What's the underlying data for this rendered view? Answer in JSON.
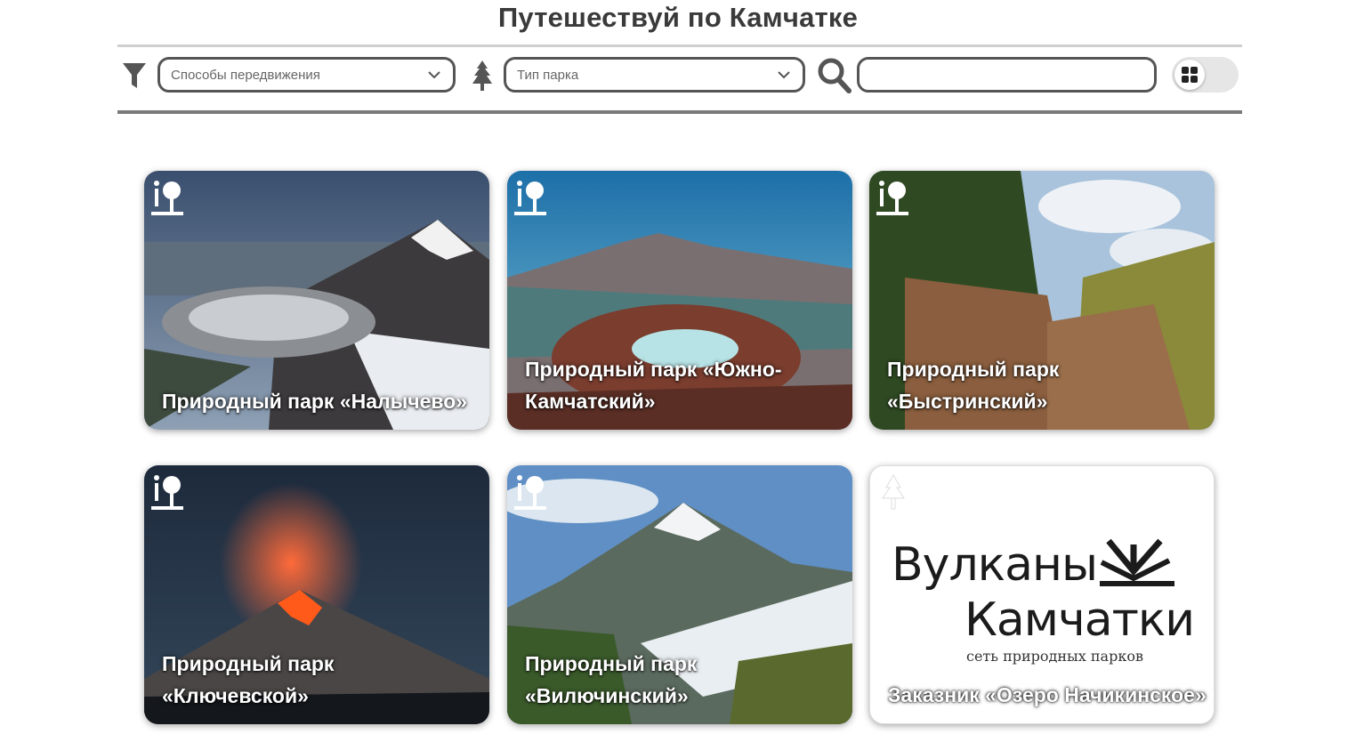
{
  "page": {
    "title": "Путешествуй по Камчатке"
  },
  "filters": {
    "transport": {
      "placeholder": "Способы передвижения"
    },
    "park_type": {
      "placeholder": "Тип парка"
    },
    "search": {
      "value": "",
      "placeholder": ""
    },
    "view_toggle": {
      "icon": "grid-icon"
    }
  },
  "cards": [
    {
      "title": "Природный парк «Налычево»",
      "icon": "park-icon",
      "image": "volcano-crater-snow"
    },
    {
      "title": "Природный парк «Южно-Камчатский»",
      "icon": "park-icon",
      "image": "crater-lake-aerial"
    },
    {
      "title": "Природный парк «Быстринский»",
      "icon": "park-icon",
      "image": "canyon-forest"
    },
    {
      "title": "Природный парк «Ключевской»",
      "icon": "park-icon",
      "image": "erupting-volcano-night"
    },
    {
      "title": "Природный парк «Вилючинский»",
      "icon": "park-icon",
      "image": "snowy-volcano-meadow"
    },
    {
      "title": "Заказник «Озеро Начикинское»",
      "icon": "reserve-icon",
      "logo": {
        "line1": "Вулканы",
        "line2": "Камчатки",
        "subtitle": "сеть природных парков"
      }
    }
  ],
  "colors": {
    "border": "#555555",
    "toggle_bg": "#e6e6e6",
    "rule_bottom": "#7a7a7a"
  }
}
